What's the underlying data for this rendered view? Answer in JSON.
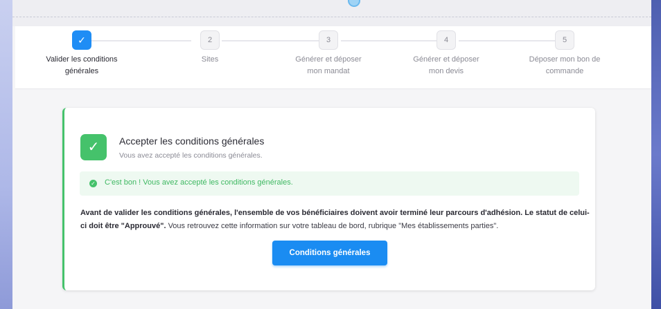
{
  "stepper": {
    "steps": [
      {
        "number": "1",
        "status": "done",
        "label_line1": "Valider les conditions",
        "label_line2": "générales"
      },
      {
        "number": "2",
        "status": "pending",
        "label_line1": "Sites",
        "label_line2": ""
      },
      {
        "number": "3",
        "status": "pending",
        "label_line1": "Générer et déposer",
        "label_line2": "mon mandat"
      },
      {
        "number": "4",
        "status": "pending",
        "label_line1": "Générer et déposer",
        "label_line2": "mon devis"
      },
      {
        "number": "5",
        "status": "pending",
        "label_line1": "Déposer mon bon de",
        "label_line2": "commande"
      }
    ],
    "done_icon": "✓"
  },
  "card": {
    "icon": "✓",
    "title": "Accepter les conditions générales",
    "subtitle": "Vous avez accepté les conditions générales.",
    "alert": {
      "icon": "✓",
      "text": "C'est bon ! Vous avez accepté les conditions générales."
    },
    "notice_bold_1": "Avant de valider les conditions générales, l'ensemble de vos bénéficiaires doivent avoir terminé leur parcours d'adhésion. Le statut de celui-ci doit être \"Approuvé\".",
    "notice_regular": " Vous retrouvez cette information sur votre tableau de bord, rubrique \"Mes établissements parties\".",
    "button_label": "Conditions générales"
  },
  "colors": {
    "accent": "#1a8cf2",
    "success": "#45c26b",
    "success_bg": "#eef9f1"
  }
}
